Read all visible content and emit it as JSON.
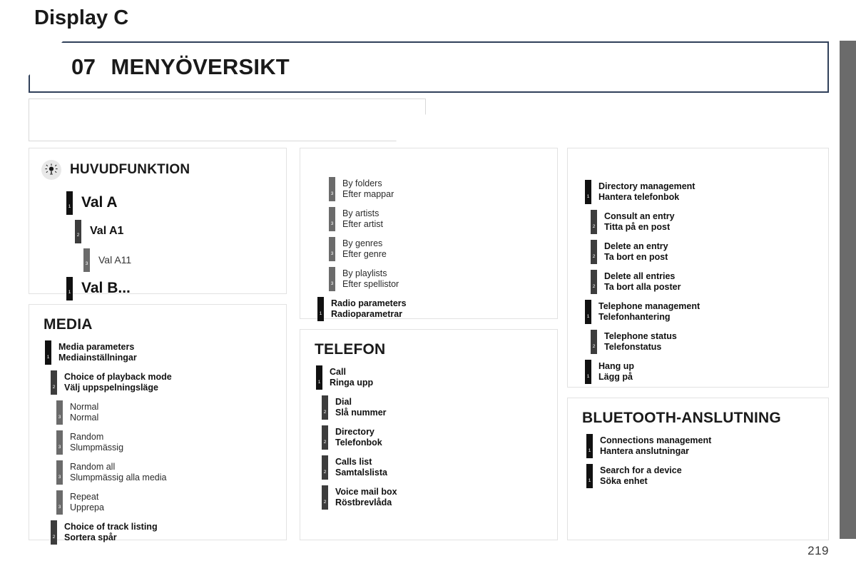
{
  "header": {
    "chapter_number": "07",
    "chapter_title": "MENYÖVERSIKT",
    "display_label": "Display C"
  },
  "legend_panel": {
    "icon": "brightness-icon",
    "title": "HUVUDFUNKTION",
    "rows": [
      {
        "level": "1",
        "label": "Val A"
      },
      {
        "level": "2",
        "label": "Val A1"
      },
      {
        "level": "3",
        "label": "Val A11"
      },
      {
        "level": "1",
        "label": "Val B..."
      }
    ]
  },
  "media_panel": {
    "title": "MEDIA",
    "entries": [
      {
        "level": "1",
        "en": "Media parameters",
        "sv": "Mediainställningar"
      },
      {
        "level": "2",
        "en": "Choice of playback mode",
        "sv": "Välj uppspelningsläge"
      },
      {
        "level": "3",
        "en": "Normal",
        "sv": "Normal"
      },
      {
        "level": "3",
        "en": "Random",
        "sv": "Slumpmässig"
      },
      {
        "level": "3",
        "en": "Random all",
        "sv": "Slumpmässig alla media"
      },
      {
        "level": "3",
        "en": "Repeat",
        "sv": "Upprepa"
      },
      {
        "level": "2",
        "en": "Choice of track listing",
        "sv": "Sortera spår"
      }
    ]
  },
  "media_continued_panel": {
    "title": "",
    "entries": [
      {
        "level": "3",
        "en": "By folders",
        "sv": "Efter mappar"
      },
      {
        "level": "3",
        "en": "By artists",
        "sv": "Efter artist"
      },
      {
        "level": "3",
        "en": "By genres",
        "sv": "Efter genre"
      },
      {
        "level": "3",
        "en": "By playlists",
        "sv": "Efter spellistor"
      },
      {
        "level": "1",
        "en": "Radio parameters",
        "sv": "Radioparametrar"
      }
    ]
  },
  "telephone_panel": {
    "title": "TELEFON",
    "entries": [
      {
        "level": "1",
        "en": "Call",
        "sv": "Ringa upp"
      },
      {
        "level": "2",
        "en": "Dial",
        "sv": "Slå nummer"
      },
      {
        "level": "2",
        "en": "Directory",
        "sv": "Telefonbok"
      },
      {
        "level": "2",
        "en": "Calls list",
        "sv": "Samtalslista"
      },
      {
        "level": "2",
        "en": "Voice mail box",
        "sv": "Röstbrevlåda"
      }
    ]
  },
  "telephone_continued_panel": {
    "title": "",
    "entries": [
      {
        "level": "1",
        "en": "Directory management",
        "sv": "Hantera telefonbok"
      },
      {
        "level": "2",
        "en": "Consult an entry",
        "sv": "Titta på en post"
      },
      {
        "level": "2",
        "en": "Delete an entry",
        "sv": "Ta bort en post"
      },
      {
        "level": "2",
        "en": "Delete all entries",
        "sv": "Ta bort alla poster"
      },
      {
        "level": "1",
        "en": "Telephone management",
        "sv": "Telefonhantering"
      },
      {
        "level": "2",
        "en": "Telephone status",
        "sv": "Telefonstatus"
      },
      {
        "level": "1",
        "en": "Hang up",
        "sv": "Lägg på"
      }
    ]
  },
  "bluetooth_panel": {
    "title": "BLUETOOTH-ANSLUTNING",
    "entries": [
      {
        "level": "1",
        "en": "Connections management",
        "sv": "Hantera anslutningar"
      },
      {
        "level": "1",
        "en": "Search for a device",
        "sv": "Söka enhet"
      }
    ]
  },
  "footer": {
    "page_number": "219"
  },
  "colors": {
    "header_border": "#30405a",
    "level1": "#111111",
    "level2": "#3d3d3d",
    "level3": "#6b6b6b",
    "panel_border": "#e2e2e2",
    "page_tab": "#6b6b6b"
  }
}
